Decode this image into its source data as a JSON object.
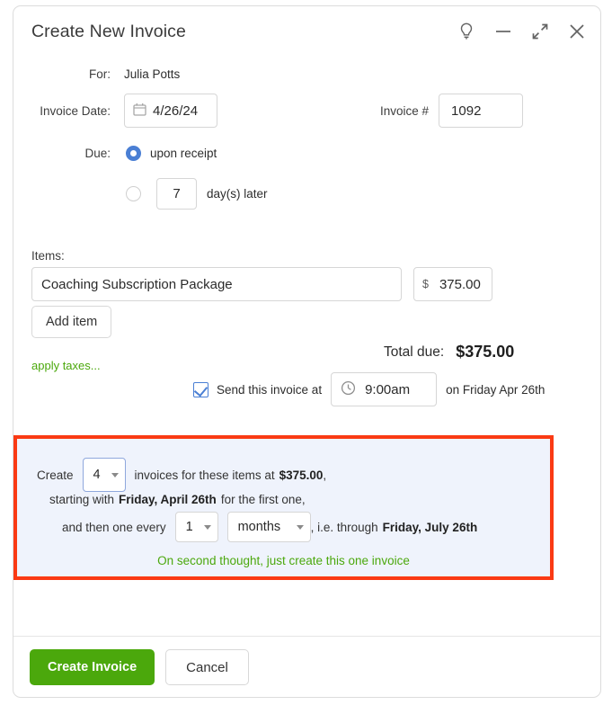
{
  "window": {
    "title": "Create New Invoice",
    "controls": [
      {
        "name": "lightbulb-icon",
        "label": "Tips"
      },
      {
        "name": "minimize-icon",
        "label": "Minimize"
      },
      {
        "name": "collapse-icon",
        "label": "Collapse"
      },
      {
        "name": "close-icon",
        "label": "Close"
      }
    ]
  },
  "form": {
    "for_label": "For:",
    "for_value": "Julia Potts",
    "invoice_date_label": "Invoice Date:",
    "invoice_date_value": "4/26/24",
    "invoice_number_label": "Invoice #",
    "invoice_number_value": "1092",
    "due_label": "Due:",
    "due_option_receipt": "upon receipt",
    "due_option_days_value": "7",
    "due_option_days_suffix": "day(s) later",
    "items_label": "Items:",
    "item_description": "Coaching Subscription Package",
    "item_currency_symbol": "$",
    "item_amount": "375.00",
    "add_item_label": "Add item",
    "apply_taxes_label": "apply taxes...",
    "total_due_label": "Total due:",
    "total_due_value": "$375.00",
    "send_invoice_label": "Send this invoice at",
    "send_invoice_time": "9:00am",
    "send_invoice_suffix": "on Friday Apr 26th"
  },
  "recurring": {
    "create_prefix": "Create",
    "count_value": "4",
    "invoices_text": "invoices for these items at",
    "amount": "$375.00",
    "amount_trailing": ",",
    "starting_prefix": "starting with",
    "starting_date": "Friday, April 26th",
    "starting_suffix": "for the first one,",
    "every_prefix": "and then one every",
    "interval_value": "1",
    "unit_value": "months",
    "through_prefix": ", i.e. through",
    "through_date": "Friday, July 26th",
    "cancel_recurring_label": "On second thought, just create this one invoice"
  },
  "footer": {
    "primary_label": "Create Invoice",
    "cancel_label": "Cancel"
  },
  "colors": {
    "accent_green": "#4ba80c",
    "accent_blue": "#4a7fd4",
    "highlight_red": "#fa3a14",
    "panel_bg": "#eff3fc"
  }
}
